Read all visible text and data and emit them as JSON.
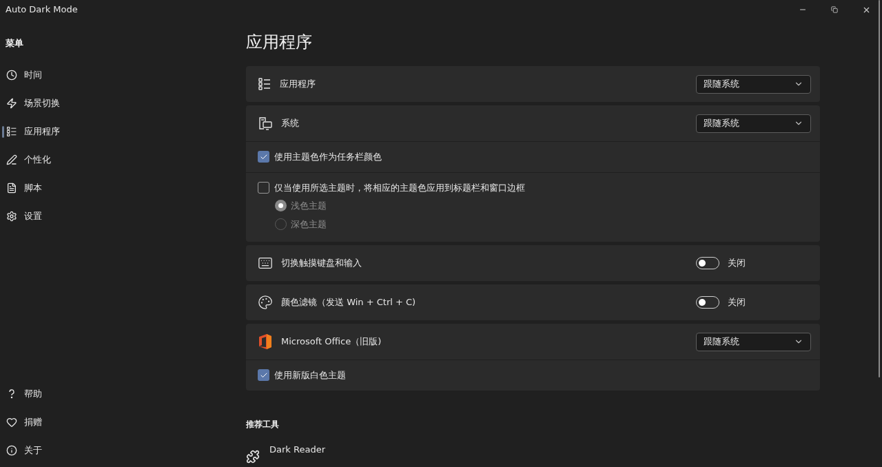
{
  "window": {
    "title": "Auto Dark Mode"
  },
  "sidebar": {
    "heading": "菜单",
    "items": [
      {
        "label": "时间",
        "selected": false
      },
      {
        "label": "场景切换",
        "selected": false
      },
      {
        "label": "应用程序",
        "selected": true
      },
      {
        "label": "个性化",
        "selected": false
      },
      {
        "label": "脚本",
        "selected": false
      },
      {
        "label": "设置",
        "selected": false
      }
    ],
    "footer_items": [
      {
        "label": "帮助",
        "selected": false
      },
      {
        "label": "捐赠",
        "selected": false
      },
      {
        "label": "关于",
        "selected": false
      }
    ]
  },
  "page": {
    "title": "应用程序",
    "cards": [
      {
        "label": "应用程序",
        "control": {
          "kind": "dropdown",
          "value": "跟随系统"
        }
      },
      {
        "label": "系统",
        "control": {
          "kind": "dropdown",
          "value": "跟随系统"
        },
        "options": [
          {
            "kind": "checkbox",
            "label": "使用主题色作为任务栏颜色",
            "checked": true
          },
          {
            "kind": "checkbox",
            "label": "仅当使用所选主题时，将相应的主题色应用到标题栏和窗口边框",
            "checked": false,
            "radios": [
              {
                "label": "浅色主题",
                "selected": true,
                "disabled": true
              },
              {
                "label": "深色主题",
                "selected": false,
                "disabled": true
              }
            ]
          }
        ]
      },
      {
        "label": "切换触摸键盘和输入",
        "control": {
          "kind": "toggle",
          "on": false,
          "state_label": "关闭"
        }
      },
      {
        "label": "颜色滤镜（发送 Win + Ctrl + C)",
        "control": {
          "kind": "toggle",
          "on": false,
          "state_label": "关闭"
        }
      },
      {
        "label": "Microsoft Office（旧版)",
        "control": {
          "kind": "dropdown",
          "value": "跟随系统"
        },
        "options": [
          {
            "kind": "checkbox",
            "label": "使用新版白色主题",
            "checked": true
          }
        ]
      }
    ]
  },
  "recommended": {
    "heading": "推荐工具",
    "items": [
      {
        "name": "Dark Reader"
      }
    ]
  }
}
